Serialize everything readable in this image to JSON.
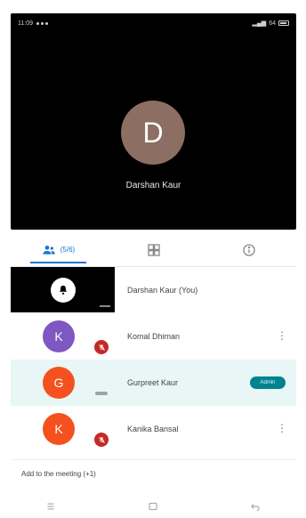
{
  "status_bar": {
    "time": "11:09",
    "battery": "64"
  },
  "video": {
    "avatar_letter": "D",
    "name": "Darshan Kaur"
  },
  "tabs": [
    {
      "label": "(5/6)",
      "icon": "people-icon",
      "active": true
    },
    {
      "label": "",
      "icon": "grid-icon",
      "active": false
    },
    {
      "label": "",
      "icon": "info-icon",
      "active": false
    }
  ],
  "participants": [
    {
      "name": "Darshan Kaur (You)",
      "letter": "",
      "color": "#000000",
      "muted": false,
      "badge": ""
    },
    {
      "name": "Komal Dhiman",
      "letter": "K",
      "color": "#7e57c2",
      "muted": true,
      "badge": ""
    },
    {
      "name": "Gurpreet Kaur",
      "letter": "G",
      "color": "#f4511e",
      "muted": false,
      "badge": "Admin"
    },
    {
      "name": "Kanika Bansal",
      "letter": "K",
      "color": "#f4511e",
      "muted": true,
      "badge": ""
    }
  ],
  "add_link": "Add to the meeting (+1)",
  "colors": {
    "accent": "#1976d2",
    "highlight_row": "#e9f6f6",
    "mute_red": "#c62828",
    "pill_teal": "#00838f"
  }
}
